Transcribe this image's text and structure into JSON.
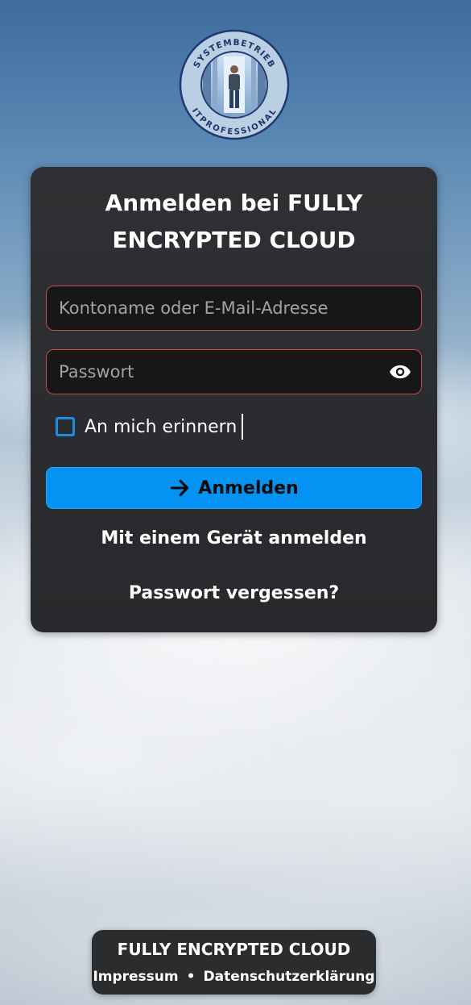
{
  "logo": {
    "ring_text_top": "SYSTEMBETRIEB",
    "ring_text_bottom": "ITPROFESSIONAL"
  },
  "login": {
    "title": "Anmelden bei FULLY ENCRYPTED CLOUD",
    "username_placeholder": "Kontoname oder E-Mail-Adresse",
    "username_value": "",
    "password_placeholder": "Passwort",
    "password_value": "",
    "remember_label": "An mich erinnern",
    "remember_checked": false,
    "submit_label": "Anmelden",
    "device_login_label": "Mit einem Gerät anmelden",
    "forgot_password_label": "Passwort vergessen?"
  },
  "icons": {
    "password_toggle": "eye-icon",
    "submit": "arrow-right-icon"
  },
  "footer": {
    "title": "FULLY ENCRYPTED CLOUD",
    "links": [
      "Impressum",
      "Datenschutzerklärung"
    ],
    "separator": "•"
  },
  "colors": {
    "accent": "#0492f3",
    "error_border": "#c94a46",
    "card_bg": "#2e3033",
    "checkbox_border": "#1b8ee8"
  }
}
